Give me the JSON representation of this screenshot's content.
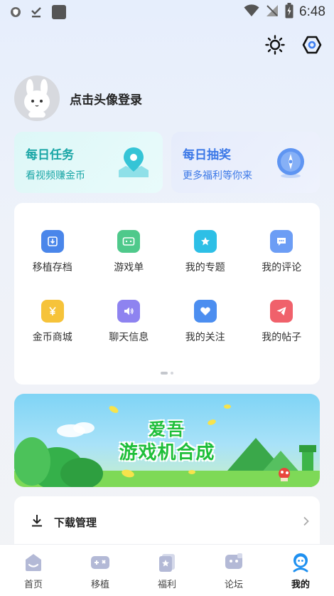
{
  "status_bar": {
    "time": "6:48",
    "icons": [
      "shield-icon",
      "download-done-icon",
      "app-square-icon",
      "wifi-icon",
      "no-signal-icon",
      "battery-charging-icon"
    ]
  },
  "header": {
    "actions": [
      "brightness-icon",
      "settings-hexagon-icon"
    ]
  },
  "profile": {
    "login_text": "点击头像登录"
  },
  "feature_cards": [
    {
      "title": "每日任务",
      "subtitle": "看视频赚金币",
      "icon": "map-pin-icon",
      "color": "#1aa6a6"
    },
    {
      "title": "每日抽奖",
      "subtitle": "更多福利等你来",
      "icon": "compass-icon",
      "color": "#3b78e7"
    }
  ],
  "grid_items": [
    {
      "label": "移植存档",
      "icon": "save-archive-icon",
      "color": "#4a86ea"
    },
    {
      "label": "游戏单",
      "icon": "game-list-icon",
      "color": "#4fc98b"
    },
    {
      "label": "我的专题",
      "icon": "topic-star-icon",
      "color": "#2dbfe6"
    },
    {
      "label": "我的评论",
      "icon": "comment-icon",
      "color": "#6c9df5"
    },
    {
      "label": "金币商城",
      "icon": "coin-shop-icon",
      "color": "#f6c33a"
    },
    {
      "label": "聊天信息",
      "icon": "speaker-icon",
      "color": "#8e83f0"
    },
    {
      "label": "我的关注",
      "icon": "heart-icon",
      "color": "#4c8ef0"
    },
    {
      "label": "我的帖子",
      "icon": "send-icon",
      "color": "#f0616b"
    }
  ],
  "banner": {
    "line1": "爱吾",
    "line2": "游戏机合成"
  },
  "list": {
    "download_label": "下载管理"
  },
  "bottom_nav": [
    {
      "label": "首页",
      "icon": "home-icon",
      "active": false
    },
    {
      "label": "移植",
      "icon": "gamepad-icon",
      "active": false
    },
    {
      "label": "福利",
      "icon": "gift-card-icon",
      "active": false
    },
    {
      "label": "论坛",
      "icon": "forum-icon",
      "active": false
    },
    {
      "label": "我的",
      "icon": "profile-icon",
      "active": true
    }
  ]
}
